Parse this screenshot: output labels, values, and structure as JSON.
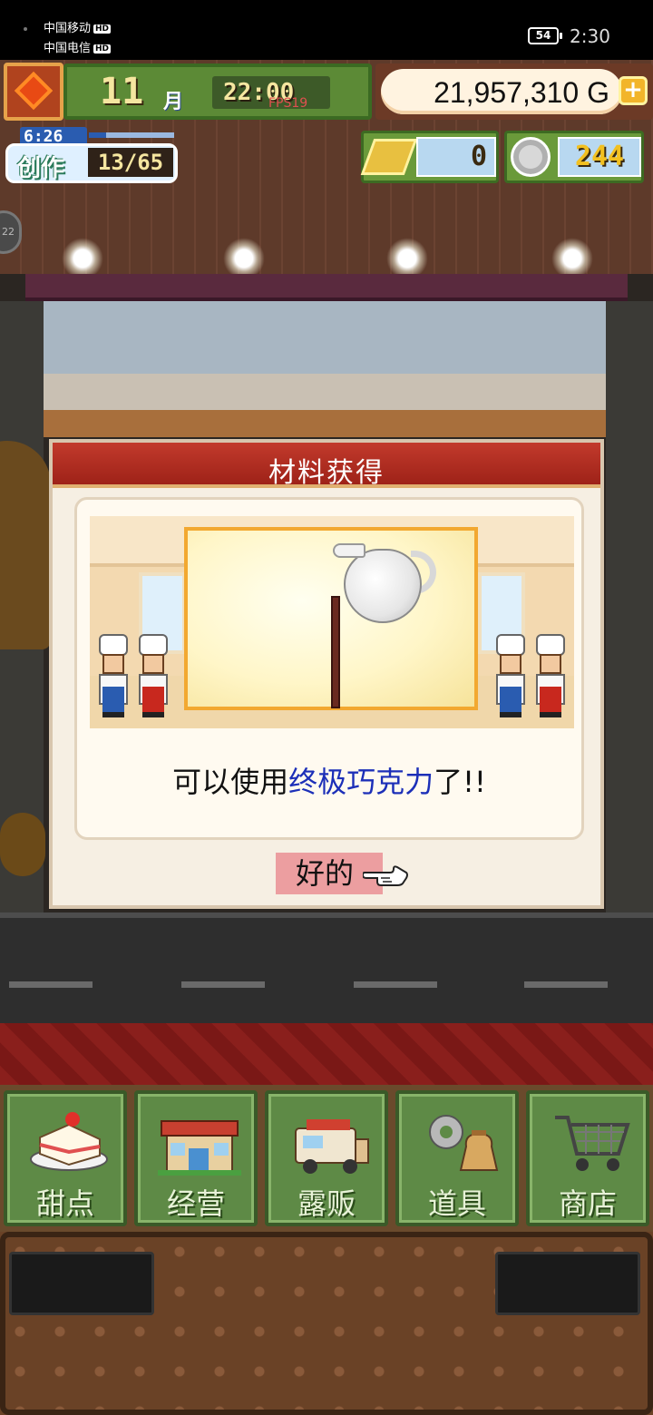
{
  "status_bar": {
    "carrier_1": "中国移动",
    "carrier_2": "中国电信",
    "hd_badge": "HD",
    "battery": "54",
    "time": "2:30"
  },
  "hud": {
    "month": "11",
    "month_unit": "月",
    "game_time": "22:00",
    "fps": "FPS19",
    "money": "21,957,310",
    "money_unit": "G",
    "money_add": "+",
    "create_timer": "6:26",
    "create_label": "创作",
    "create_count": "13/65",
    "progress_ratio": 0.2,
    "gold_bars": "0",
    "medals": "244",
    "side_badge": "22"
  },
  "dialog": {
    "title": "材料获得",
    "message_prefix": "可以使用",
    "message_highlight": "终极巧克力",
    "message_suffix": "了!!",
    "ok_button": "好的",
    "item_icon": "milk-jug-icon"
  },
  "menu": {
    "items": [
      {
        "label": "甜点",
        "icon": "cake-icon"
      },
      {
        "label": "经营",
        "icon": "shop-icon"
      },
      {
        "label": "露贩",
        "icon": "food-truck-icon"
      },
      {
        "label": "道具",
        "icon": "gear-bag-icon"
      },
      {
        "label": "商店",
        "icon": "cart-icon"
      }
    ]
  },
  "colors": {
    "dialog_header": "#b02c20",
    "highlight_text": "#1c2fb8",
    "ok_button": "#ec9ea0",
    "menu_button": "#5e8a46"
  }
}
